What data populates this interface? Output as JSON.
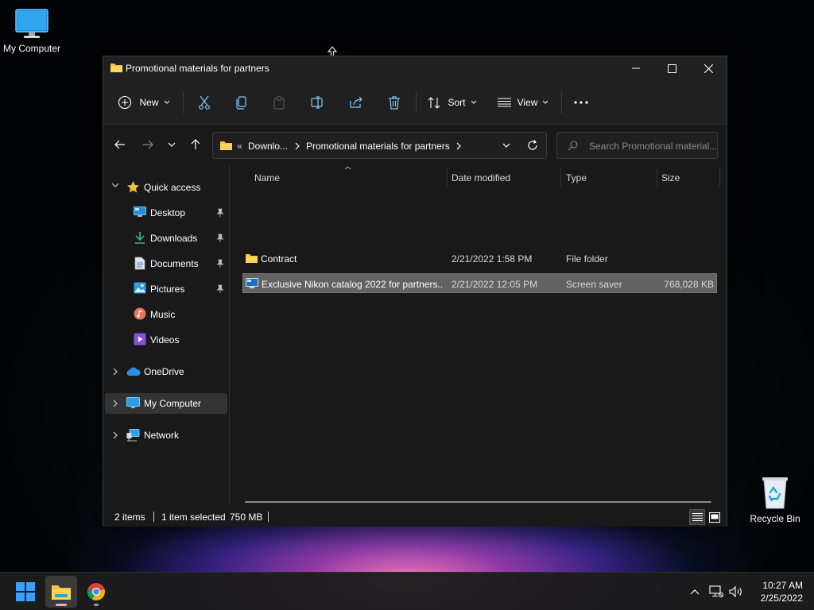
{
  "desktop": {
    "my_computer_label": "My Computer",
    "recycle_bin_label": "Recycle Bin"
  },
  "window": {
    "title": "Promotional materials for partners",
    "toolbar": {
      "new_label": "New",
      "sort_label": "Sort",
      "view_label": "View"
    },
    "address": {
      "overflow": "«",
      "crumbs": [
        "Downlo...",
        "Promotional materials for partners"
      ]
    },
    "search": {
      "placeholder": "Search Promotional material..."
    },
    "sidebar": {
      "quick_access": "Quick access",
      "items": [
        {
          "label": "Desktop",
          "icon": "desktop-icon",
          "pinned": true
        },
        {
          "label": "Downloads",
          "icon": "downloads-icon",
          "pinned": true
        },
        {
          "label": "Documents",
          "icon": "documents-icon",
          "pinned": true
        },
        {
          "label": "Pictures",
          "icon": "pictures-icon",
          "pinned": true
        },
        {
          "label": "Music",
          "icon": "music-icon",
          "pinned": false
        },
        {
          "label": "Videos",
          "icon": "videos-icon",
          "pinned": false
        }
      ],
      "onedrive": "OneDrive",
      "my_computer": "My Computer",
      "network": "Network"
    },
    "columns": {
      "name": "Name",
      "date": "Date modified",
      "type": "Type",
      "size": "Size"
    },
    "files": [
      {
        "name": "Contract",
        "date": "2/21/2022 1:58 PM",
        "type": "File folder",
        "size": "",
        "icon": "folder-icon",
        "selected": false
      },
      {
        "name": "Exclusive Nikon catalog 2022 for partners...",
        "date": "2/21/2022 12:05 PM",
        "type": "Screen saver",
        "size": "768,028 KB",
        "icon": "screensaver-icon",
        "selected": true
      }
    ],
    "status": {
      "items": "2 items",
      "selected": "1 item selected",
      "size": "750 MB"
    }
  },
  "taskbar": {
    "time": "10:27 AM",
    "date": "2/25/2022"
  },
  "colors": {
    "window_bg": "#191919",
    "toolbar_bg": "#202020",
    "selection": "#626262",
    "accent_blue": "#3aa0ff",
    "folder_yellow": "#f4c23f"
  }
}
